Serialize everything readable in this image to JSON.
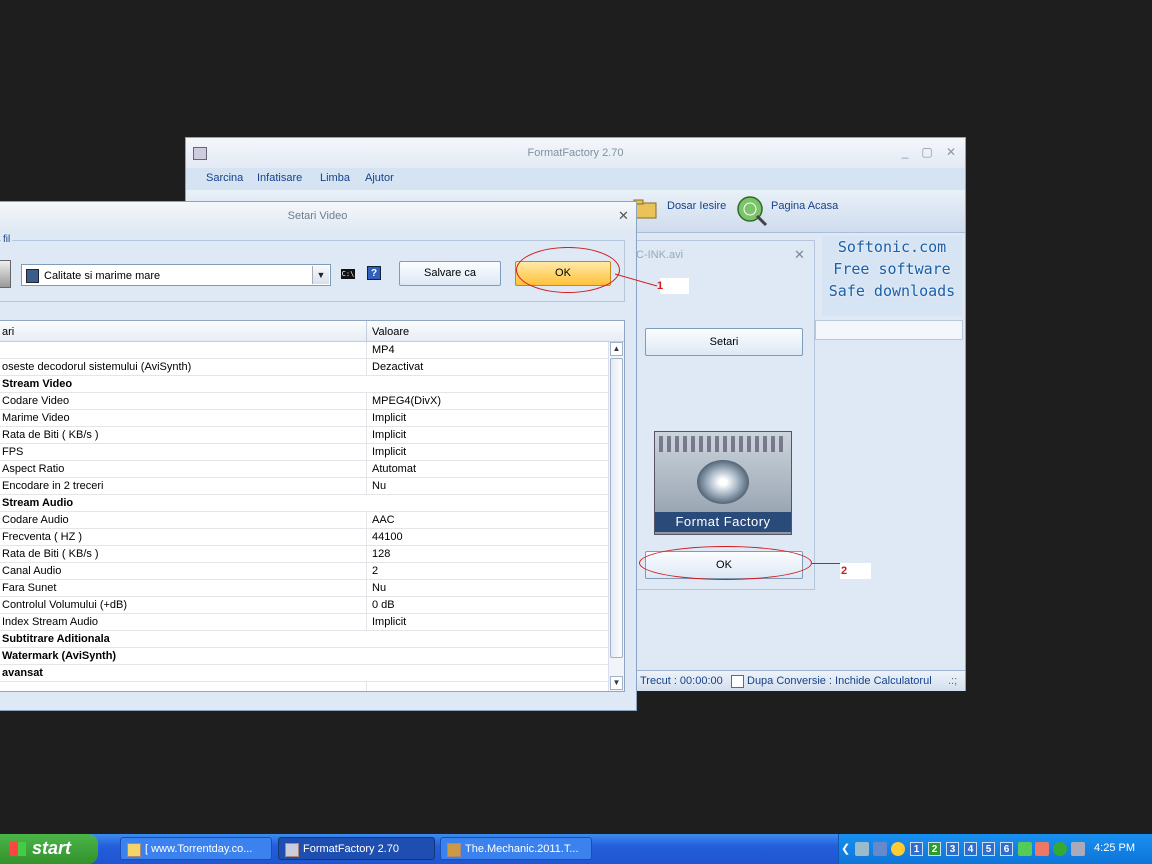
{
  "main_window": {
    "title": "FormatFactory 2.70",
    "menu": [
      "Sarcina",
      "Infatisare",
      "Limba",
      "Ajutor"
    ],
    "toolbar": {
      "output_folder": "Dosar Iesire",
      "home_page": "Pagina Acasa"
    },
    "ad": [
      "Softonic.com",
      "Free software",
      "Safe downloads"
    ],
    "status": {
      "elapsed": "Trecut : 00:00:00",
      "after_conversion": "Dupa Conversie : Inchide Calculatorul"
    }
  },
  "file_dialog": {
    "title_fragment": "C-INK.avi",
    "settings_button": "Setari",
    "logo_text": "Format Factory",
    "ok_button": "OK"
  },
  "settings_dialog": {
    "title": "Setari Video",
    "group_label": "fil",
    "profile_value": "Calitate si marime mare",
    "cmd_icon_text": "C:\\",
    "help_icon_text": "?",
    "save_as_button": "Salvare ca",
    "ok_button": "OK",
    "table": {
      "headers": [
        "ari",
        "Valoare"
      ],
      "rows": [
        {
          "name": "",
          "value": "MP4",
          "section": false
        },
        {
          "name": "oseste decodorul sistemului (AviSynth)",
          "value": "Dezactivat",
          "section": false
        },
        {
          "name": "Stream Video",
          "value": "",
          "section": true
        },
        {
          "name": "Codare Video",
          "value": "MPEG4(DivX)",
          "section": false
        },
        {
          "name": "Marime Video",
          "value": "Implicit",
          "section": false
        },
        {
          "name": "Rata de Biti ( KB/s )",
          "value": "Implicit",
          "section": false
        },
        {
          "name": "FPS",
          "value": "Implicit",
          "section": false
        },
        {
          "name": "Aspect Ratio",
          "value": "Atutomat",
          "section": false
        },
        {
          "name": "Encodare in 2 treceri",
          "value": "Nu",
          "section": false
        },
        {
          "name": "Stream Audio",
          "value": "",
          "section": true
        },
        {
          "name": "Codare Audio",
          "value": "AAC",
          "section": false
        },
        {
          "name": "Frecventa ( HZ )",
          "value": "44100",
          "section": false
        },
        {
          "name": "Rata de Biti ( KB/s )",
          "value": "128",
          "section": false
        },
        {
          "name": "Canal Audio",
          "value": "2",
          "section": false
        },
        {
          "name": "Fara Sunet",
          "value": "Nu",
          "section": false
        },
        {
          "name": "Controlul Volumului (+dB)",
          "value": "0 dB",
          "section": false
        },
        {
          "name": "Index Stream Audio",
          "value": "Implicit",
          "section": false
        },
        {
          "name": "Subtitrare Aditionala",
          "value": "",
          "section": true
        },
        {
          "name": "Watermark (AviSynth)",
          "value": "",
          "section": true
        },
        {
          "name": "avansat",
          "value": "",
          "section": true
        },
        {
          "name": "",
          "value": "",
          "section": false
        }
      ]
    }
  },
  "annotations": {
    "one": "1",
    "two": "2"
  },
  "taskbar": {
    "start": "start",
    "tasks": [
      "[ www.Torrentday.co...",
      "FormatFactory 2.70",
      "The.Mechanic.2011.T..."
    ],
    "tray_numbers": [
      "1",
      "2",
      "3",
      "4",
      "5",
      "6"
    ],
    "clock": "4:25 PM"
  }
}
